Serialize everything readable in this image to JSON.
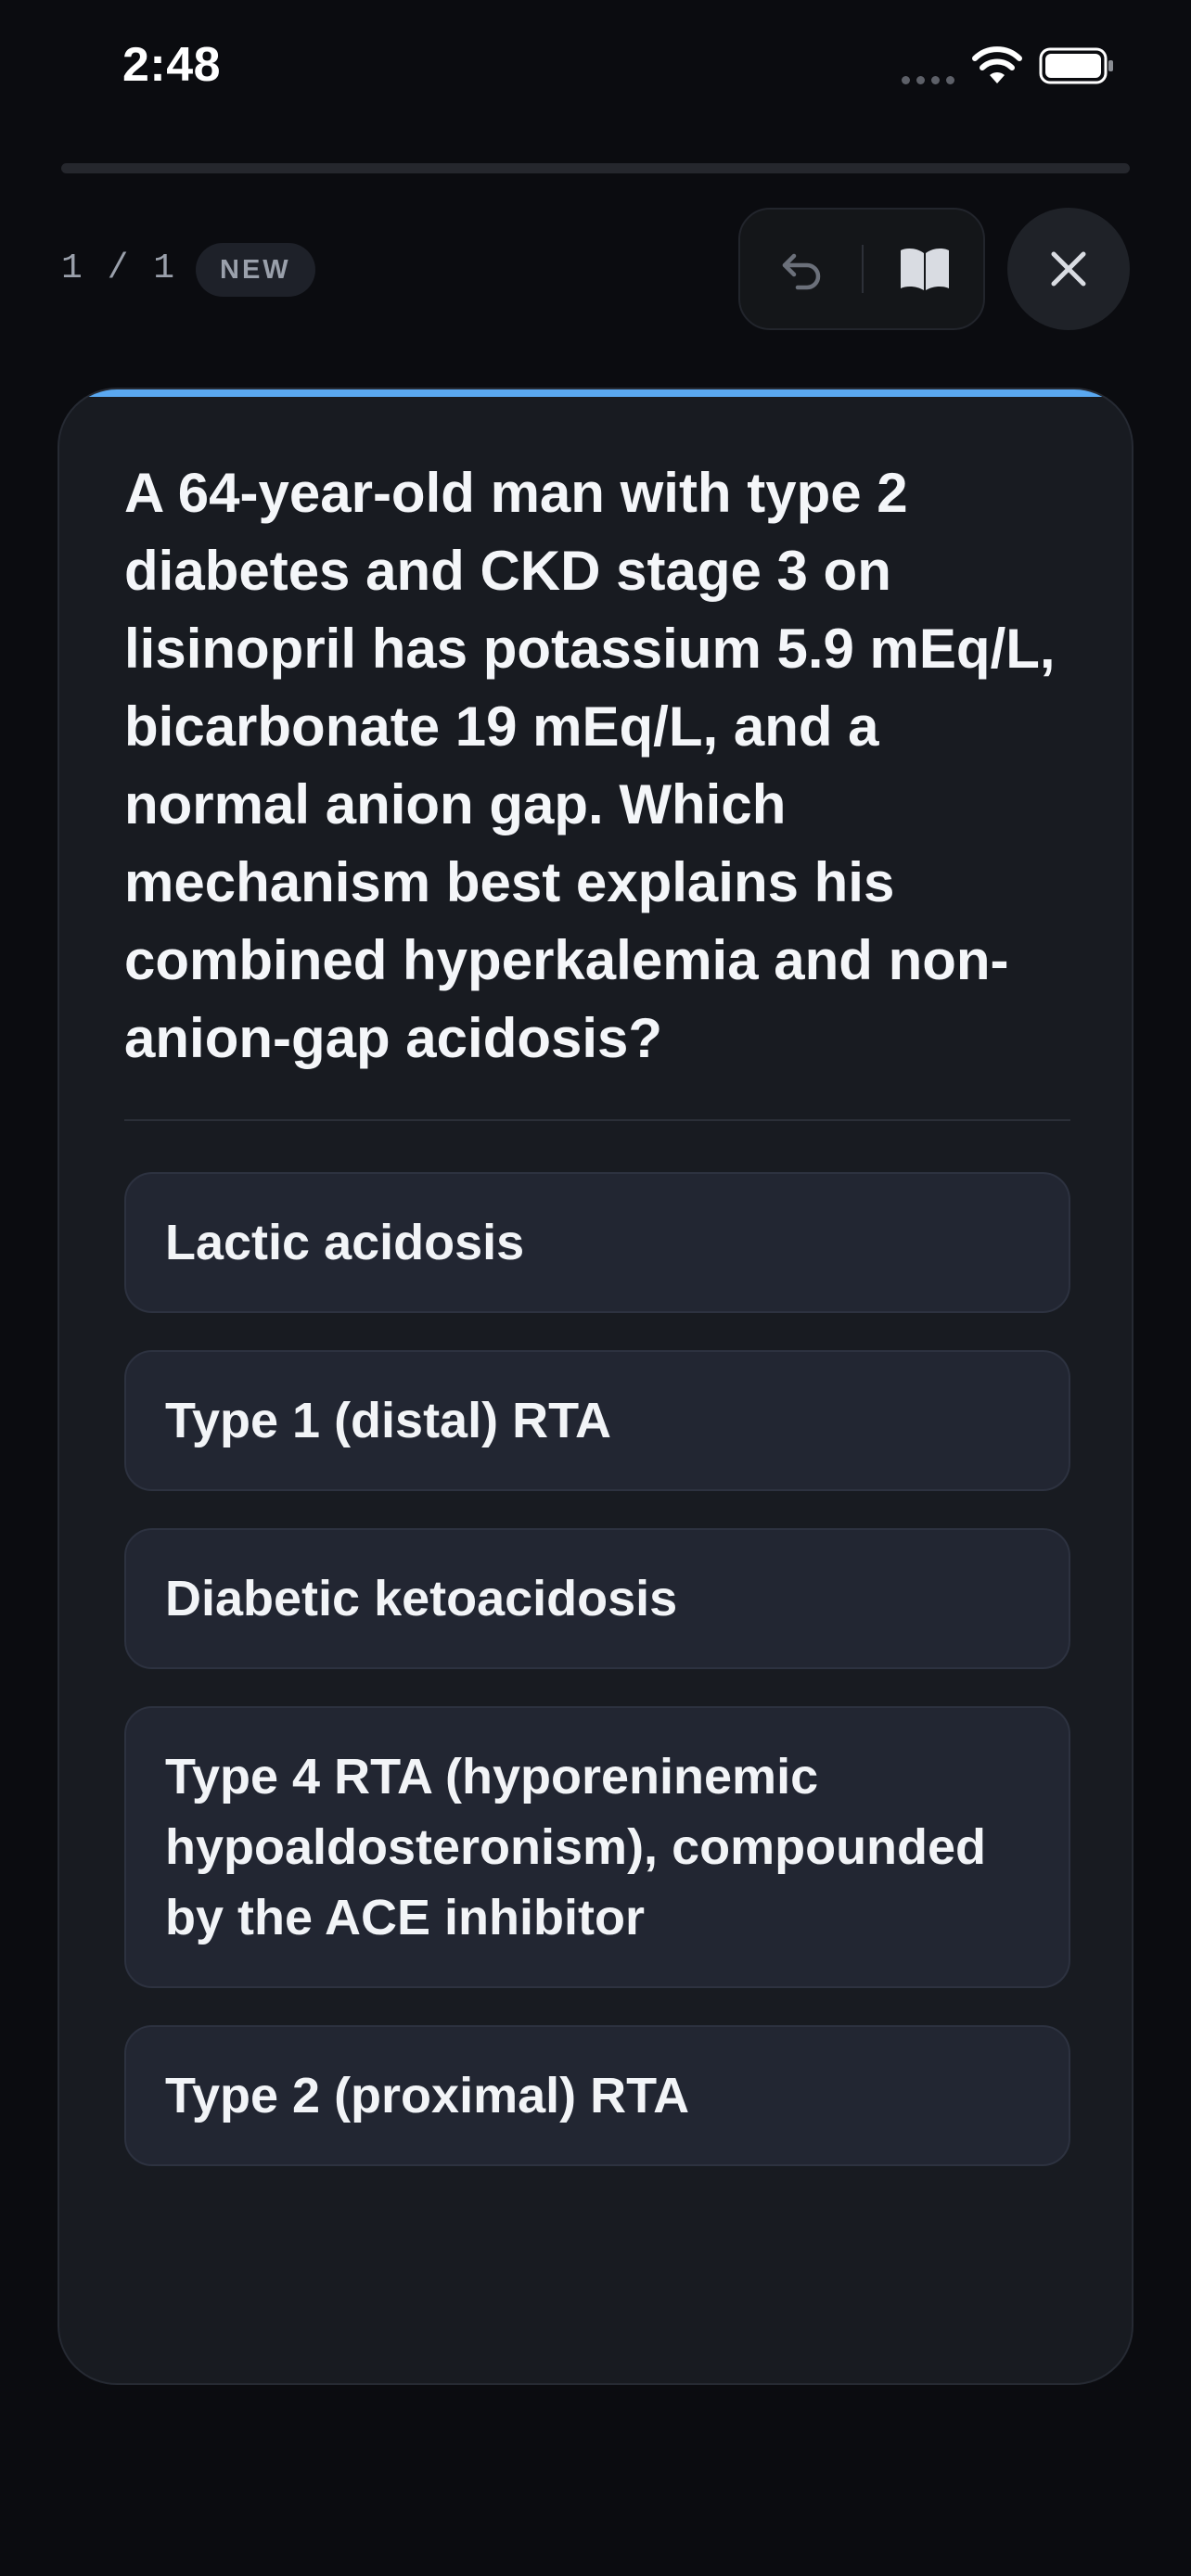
{
  "status_bar": {
    "time": "2:48"
  },
  "progress": {
    "fraction": 0.0
  },
  "header": {
    "counter": "1 / 1",
    "badge": "NEW"
  },
  "toolbar": {
    "undo_icon": "undo-arrow-icon",
    "book_icon": "open-book-icon",
    "close_icon": "close-x-icon"
  },
  "card": {
    "accent_color": "#5aa8f0",
    "question": "A 64-year-old man with type 2 diabetes and CKD stage 3 on lisinopril has potassium 5.9 mEq/L, bicarbonate 19 mEq/L, and a normal anion gap. Which mechanism best explains his combined hyperkalemia and non-anion-gap acidosis?",
    "options": [
      {
        "label": "Lactic acidosis"
      },
      {
        "label": "Type 1 (distal) RTA"
      },
      {
        "label": "Diabetic ketoacidosis"
      },
      {
        "label": "Type 4 RTA (hyporeninemic hypoaldosteronism), compounded by the ACE inhibitor"
      },
      {
        "label": "Type 2 (proximal) RTA"
      }
    ]
  }
}
